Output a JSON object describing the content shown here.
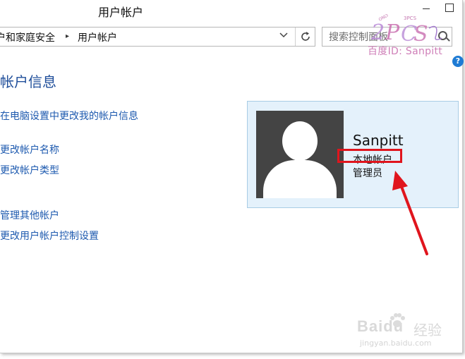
{
  "window": {
    "title": "用户帐户"
  },
  "address_bar": {
    "crumb_1": "户和家庭安全",
    "separator": "▸",
    "crumb_2": "用户帐户",
    "dropdown_icon": "chevron-down-icon",
    "refresh_icon": "refresh-icon"
  },
  "search": {
    "placeholder": "搜索控制面板",
    "icon": "search-icon"
  },
  "help": {
    "label": "?"
  },
  "watermark": {
    "id_text": "百度ID: Sanpitt",
    "baidu_logo": "Baidu",
    "baidu_cn": "经验",
    "baidu_url": "jingyan.baidu.com"
  },
  "main": {
    "title": "帐户信息",
    "links": [
      "在电脑设置中更改我的帐户信息",
      "更改帐户名称",
      "更改帐户类型",
      "管理其他帐户",
      "更改用户帐户控制设置"
    ]
  },
  "user_card": {
    "name": "Sanpitt",
    "account_type": "本地帐户",
    "role": "管理员"
  },
  "colors": {
    "link": "#1e5aaf",
    "title": "#1f4e9a",
    "card_bg": "#e4f1fb",
    "card_border": "#a8cce5",
    "highlight": "#e0151d"
  }
}
